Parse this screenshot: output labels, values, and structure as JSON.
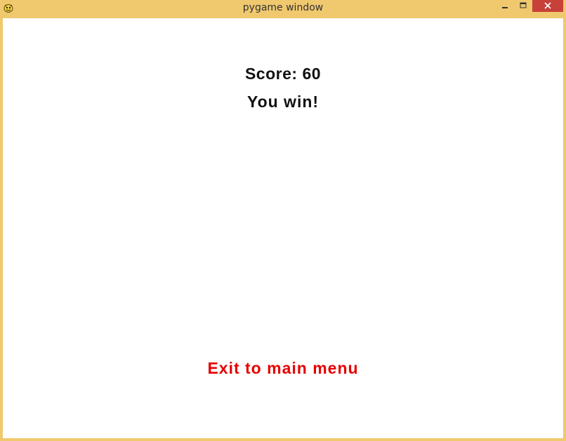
{
  "window": {
    "title": "pygame window",
    "app_icon": "pygame-snake-icon",
    "controls": {
      "minimize_icon": "minimize-icon",
      "maximize_icon": "maximize-icon",
      "close_icon": "close-icon"
    },
    "frame_color": "#f0c86e",
    "close_button_color": "#c7413a"
  },
  "game": {
    "score_text": "Score: 60",
    "result_text": "You win!",
    "exit_label": "Exit to main menu",
    "exit_color": "#e60000",
    "background": "#ffffff"
  }
}
